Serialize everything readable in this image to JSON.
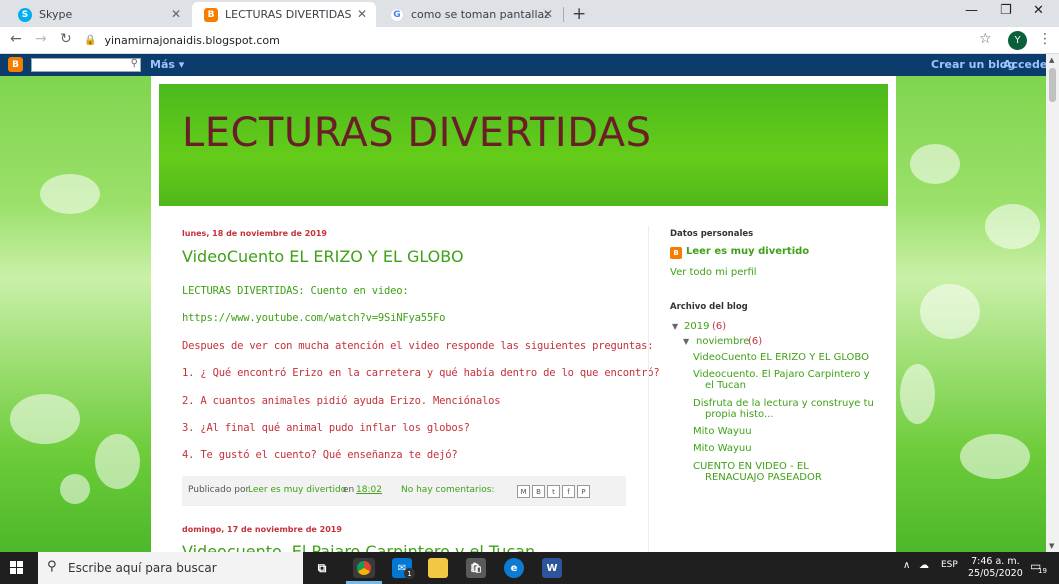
{
  "browser": {
    "tabs": [
      {
        "label": "Skype",
        "icon": "skype-icon",
        "active": false
      },
      {
        "label": "LECTURAS DIVERTIDAS",
        "icon": "blogger-icon",
        "active": true
      },
      {
        "label": "como se toman pantallazos en un",
        "icon": "google-icon",
        "active": false
      }
    ],
    "new_tab": "+",
    "url": "yinamirnajonaidis.blogspot.com",
    "profile_initial": "Y"
  },
  "blogger_nav": {
    "more_label": "Más ▾",
    "create_blog": "Crear un blog",
    "sign_in": "Acceder"
  },
  "blog": {
    "title": "LECTURAS DIVERTIDAS",
    "colors": {
      "header_green": "#5cc41c",
      "title_red": "#6b1e27",
      "link_green": "#3fa117",
      "date_red": "#c3323b"
    },
    "post1": {
      "date": "lunes, 18 de noviembre de 2019",
      "title": "VideoCuento EL ERIZO Y EL GLOBO",
      "lines": [
        "LECTURAS DIVERTIDAS: Cuento en video:",
        "https://www.youtube.com/watch?v=9SiNFya55Fo",
        "Despues de ver con mucha atención el video responde las siguientes preguntas:",
        "1. ¿ Qué encontró Erizo en la carretera y qué había dentro de lo que encontró?",
        "2. A  cuantos animales pidió ayuda Erizo. Menciónalos",
        "3. ¿Al final qué animal pudo inflar los globos?",
        "4. Te gustó el cuento? Qué enseñanza te dejó?"
      ],
      "footer": {
        "posted_by": "Publicado por",
        "author": "Leer es muy divertido",
        "at": "en",
        "time": "18:02",
        "comments": "No hay comentarios:"
      },
      "share_buttons": [
        "M",
        "B",
        "t",
        "f",
        "P"
      ]
    },
    "post2": {
      "date": "domingo, 17 de noviembre de 2019",
      "title": "Videocuento. El Pajaro Carpintero y el Tucan"
    }
  },
  "sidebar": {
    "profile_heading": "Datos personales",
    "profile_name": "Leer es muy divertido",
    "profile_link": "Ver todo mi perfil",
    "archive_heading": "Archivo del blog",
    "year": "2019",
    "year_count": "(6)",
    "month": "noviembre",
    "month_count": "(6)",
    "posts": [
      "VideoCuento EL ERIZO Y EL GLOBO",
      "Videocuento. El Pajaro Carpintero y",
      "el Tucan",
      "Disfruta de la lectura y construye tu",
      "propia histo...",
      "Mito Wayuu",
      "Mito Wayuu",
      "CUENTO EN VIDEO - EL",
      "RENACUAJO PASEADOR"
    ]
  },
  "taskbar": {
    "search_placeholder": "Escribe aquí para buscar",
    "mail_badge": "1",
    "lang": "ESP",
    "time": "7:46 a. m.",
    "date": "25/05/2020",
    "notif_count": "19"
  }
}
